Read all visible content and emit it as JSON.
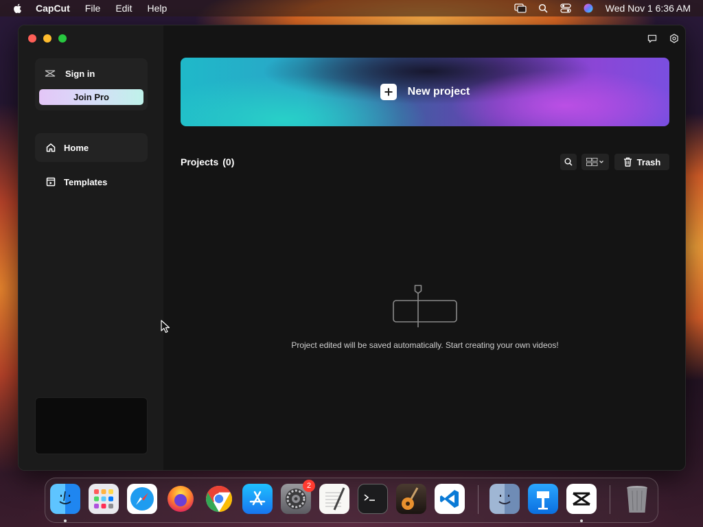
{
  "menubar": {
    "app_name": "CapCut",
    "menus": [
      "File",
      "Edit",
      "Help"
    ],
    "status_icons": [
      "screen-mirroring-icon",
      "search-icon",
      "control-center-icon",
      "siri-icon"
    ],
    "clock": "Wed Nov 1  6:36 AM"
  },
  "sidebar": {
    "sign_in_label": "Sign in",
    "join_pro_label": "Join Pro",
    "nav": [
      {
        "label": "Home",
        "icon": "home-icon",
        "active": true
      },
      {
        "label": "Templates",
        "icon": "templates-icon",
        "active": false
      }
    ]
  },
  "main": {
    "new_project_label": "New project",
    "projects_label": "Projects",
    "projects_count": "(0)",
    "trash_label": "Trash",
    "empty_message": "Project edited will be saved automatically. Start creating your own videos!"
  },
  "dock": {
    "apps": [
      "finder-icon",
      "launchpad-icon",
      "safari-icon",
      "firefox-icon",
      "chrome-icon",
      "app-store-icon",
      "system-settings-icon",
      "textedit-icon",
      "terminal-icon",
      "garageband-icon",
      "vscode-icon",
      "finder-downloads-icon",
      "keynote-icon",
      "capcut-icon",
      "trash-icon"
    ],
    "settings_badge": "2"
  },
  "colors": {
    "window_bg": "#141414",
    "sidebar_bg": "#1b1b1b",
    "accent_teal": "#1fb9c9",
    "accent_purple": "#8b46d6"
  }
}
